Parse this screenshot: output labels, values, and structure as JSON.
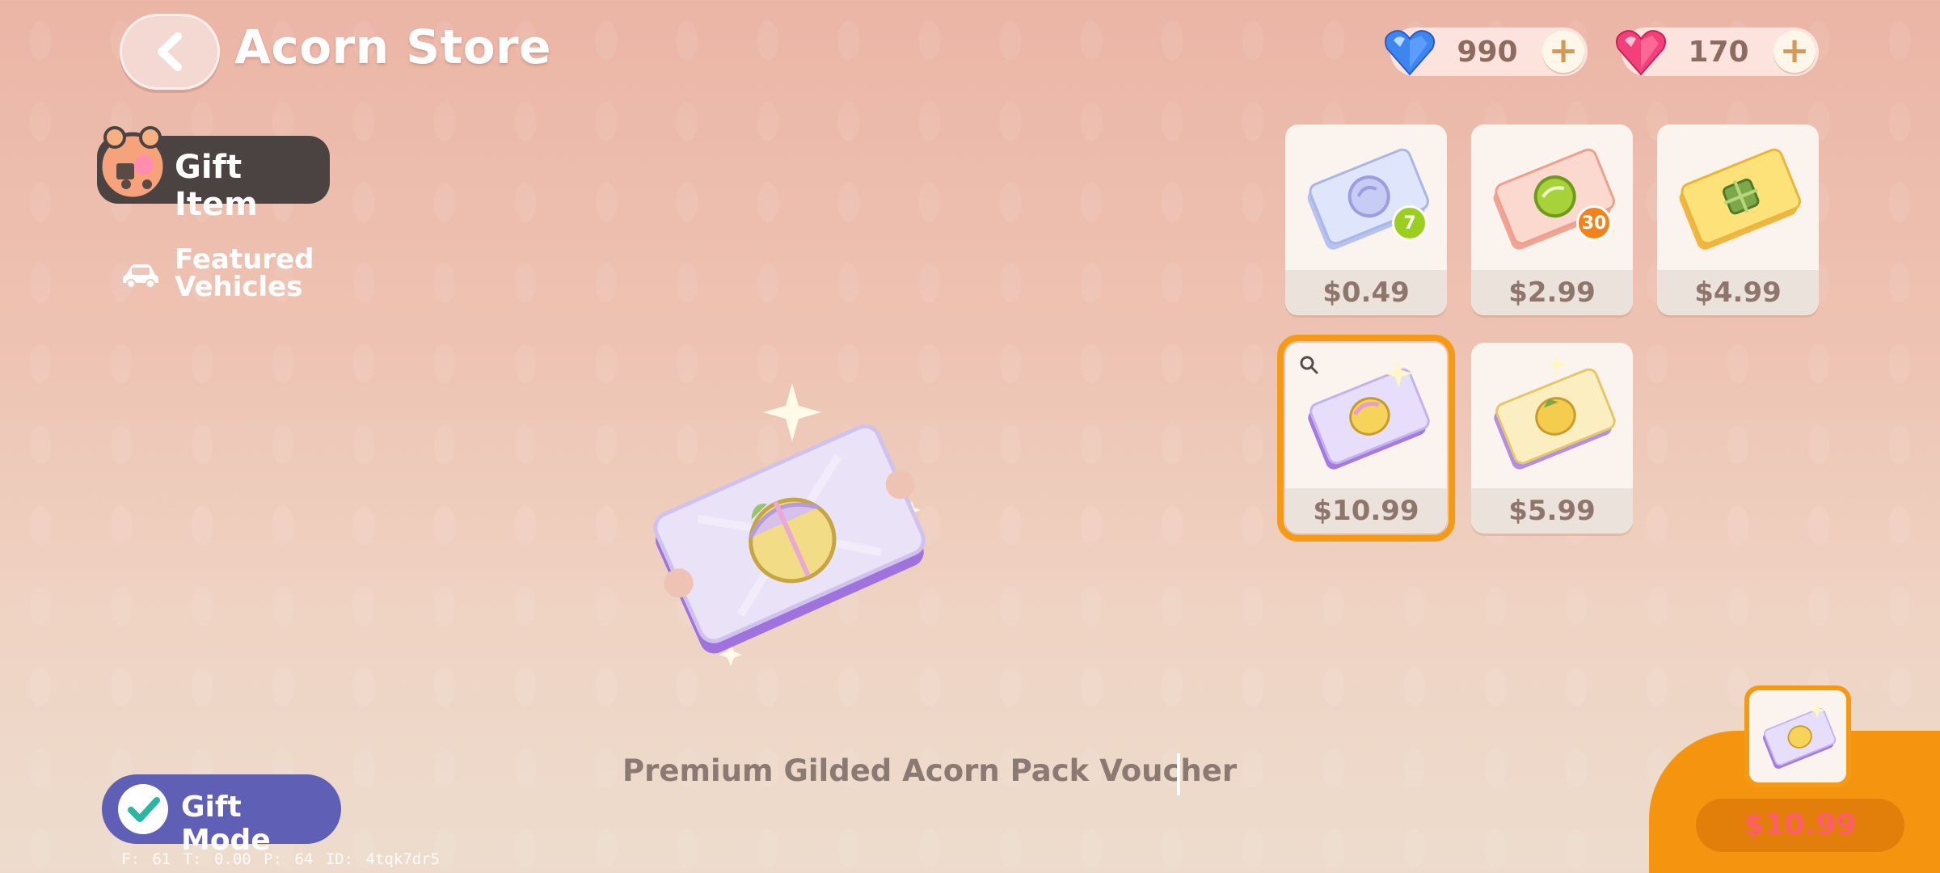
{
  "header": {
    "title": "Acorn Store",
    "back_icon": "chevron-left-icon"
  },
  "currency": [
    {
      "icon": "blue-heart-gem-icon",
      "value": "990",
      "plus": "+"
    },
    {
      "icon": "pink-heart-gem-icon",
      "value": "170",
      "plus": "+"
    }
  ],
  "sidebar": {
    "items": [
      {
        "label": "Gift Item",
        "icon": "gift-item-icon",
        "active": true
      },
      {
        "label": "Featured Vehicles",
        "icon": "car-icon",
        "active": false
      }
    ]
  },
  "products": [
    {
      "price": "$0.49",
      "badge": "7",
      "badge_color": "#9bcf1f",
      "ticket": "blue"
    },
    {
      "price": "$2.99",
      "badge": "30",
      "badge_color": "#f2831c",
      "ticket": "peach"
    },
    {
      "price": "$4.99",
      "badge": "",
      "ticket": "gold"
    },
    {
      "price": "$10.99",
      "badge": "",
      "ticket": "holo",
      "selected": true
    },
    {
      "price": "$5.99",
      "badge": "",
      "ticket": "holo-gold"
    }
  ],
  "preview": {
    "item_name": "Premium Gilded Acorn Pack Voucher"
  },
  "gift_mode": {
    "label": "Gift Mode",
    "checked": true
  },
  "debug": "F: 61   T: 0.00   P: 64   ID: 4tqk7dr5",
  "purchase": {
    "price": "$10.99"
  },
  "colors": {
    "accent": "#f59a14",
    "sidebar_active": "#4b4342",
    "gift_mode": "#5f5fb6",
    "price_text": "#ff5d6a"
  }
}
